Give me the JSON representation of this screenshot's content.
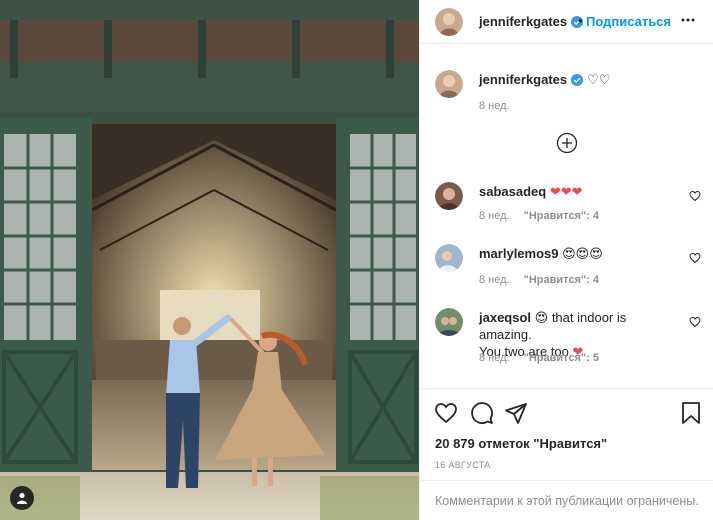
{
  "post": {
    "author": "jenniferkgates",
    "follow_label": "Подписаться",
    "dot": "•"
  },
  "caption": {
    "username": "jenniferkgates",
    "text": "♡♡",
    "time": "8 нед."
  },
  "comments": [
    {
      "username": "sabasadeq",
      "text": "❤❤❤",
      "time": "8 нед.",
      "likes": "\"Нравится\": 4"
    },
    {
      "username": "marlylemos9",
      "text": "😍😍😍",
      "time": "8 нед.",
      "likes": "\"Нравится\": 4"
    },
    {
      "username": "jaxeqsol",
      "text_a": "😍 that indoor is amazing.",
      "text_b": "You two are too ",
      "heart": "❤",
      "time": "8 нед.",
      "likes": "\"Нравится\": 5"
    }
  ],
  "stats": {
    "likes": "20 879 отметок \"Нравится\"",
    "date": "16 АВГУСТА"
  },
  "footer": {
    "comments_limited": "Комментарии к этой публикации ограничены."
  },
  "colors": {
    "accent": "#0095f6",
    "verified": "#3897f0",
    "heart": "#ed4956",
    "muted": "#8e8e8e"
  },
  "icons": [
    "user-tag-icon",
    "verified-badge-icon",
    "more-options-icon",
    "load-more-icon",
    "like-icon",
    "comment-icon",
    "share-icon",
    "save-icon"
  ]
}
